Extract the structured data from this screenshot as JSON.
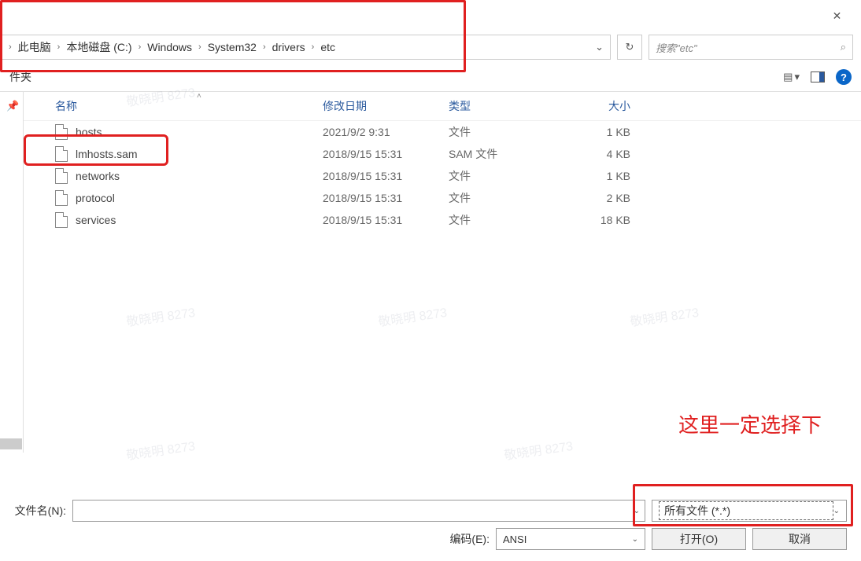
{
  "titlebar": {
    "close": "✕"
  },
  "breadcrumb": {
    "items": [
      "此电脑",
      "本地磁盘 (C:)",
      "Windows",
      "System32",
      "drivers",
      "etc"
    ]
  },
  "refresh_glyph": "↻",
  "search": {
    "placeholder": "搜索\"etc\"",
    "icon": "⌕"
  },
  "toolbar": {
    "left_label": "件夹",
    "view_label": "▦▾",
    "help": "?"
  },
  "columns": {
    "name": "名称",
    "date": "修改日期",
    "type": "类型",
    "size": "大小"
  },
  "files": [
    {
      "name": "hosts",
      "date": "2021/9/2 9:31",
      "type": "文件",
      "size": "1 KB"
    },
    {
      "name": "lmhosts.sam",
      "date": "2018/9/15 15:31",
      "type": "SAM 文件",
      "size": "4 KB"
    },
    {
      "name": "networks",
      "date": "2018/9/15 15:31",
      "type": "文件",
      "size": "1 KB"
    },
    {
      "name": "protocol",
      "date": "2018/9/15 15:31",
      "type": "文件",
      "size": "2 KB"
    },
    {
      "name": "services",
      "date": "2018/9/15 15:31",
      "type": "文件",
      "size": "18 KB"
    }
  ],
  "bottom": {
    "filename_label": "文件名(N):",
    "filetype_value": "所有文件 (*.*)",
    "encoding_label": "编码(E):",
    "encoding_value": "ANSI",
    "open_label": "打开(O)",
    "cancel_label": "取消"
  },
  "annotation": "这里一定选择下",
  "watermark": "敬晓明 8273"
}
